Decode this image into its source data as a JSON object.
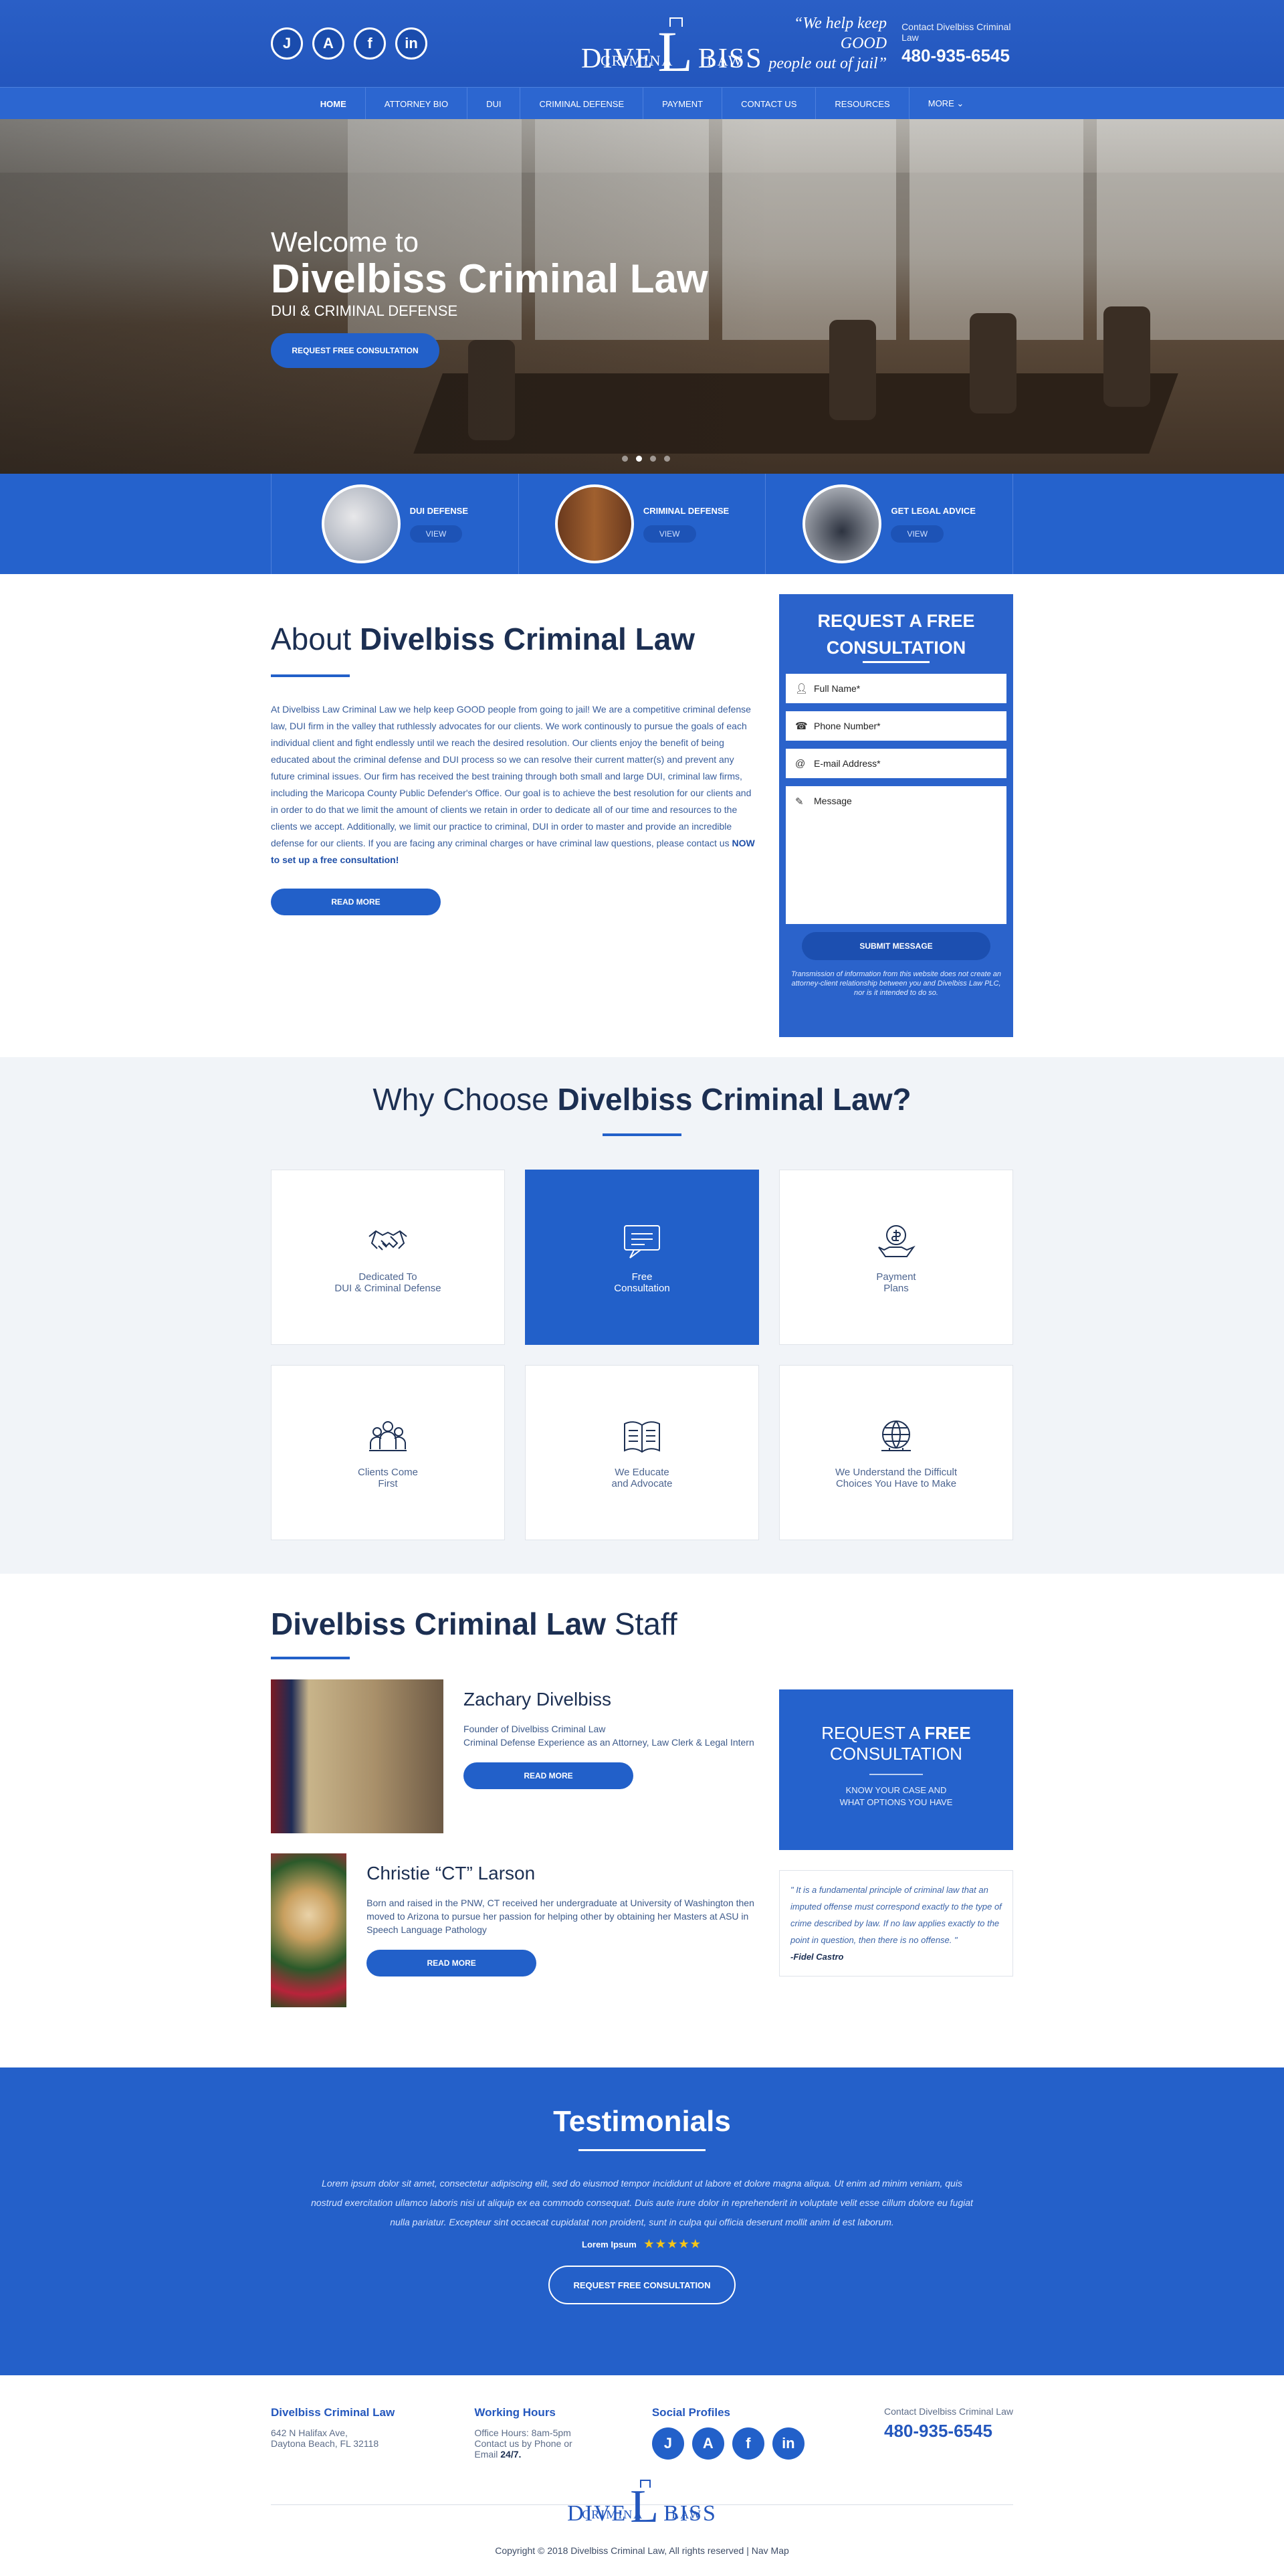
{
  "header": {
    "socials": [
      "J",
      "A",
      "f",
      "in"
    ],
    "logo": {
      "left": "DIVE",
      "L": "L",
      "right": "BISS",
      "sub_left": "CRIMINA",
      "sub_right": "LAW"
    },
    "slogan_line1": "“We help keep GOOD",
    "slogan_line2": "people out of jail”",
    "contact_label": "Contact Divelbiss Criminal Law",
    "phone": "480-935-6545"
  },
  "nav": [
    "HOME",
    "ATTORNEY BIO",
    "DUI",
    "CRIMINAL DEFENSE",
    "PAYMENT",
    "CONTACT US",
    "RESOURCES",
    "MORE ⌄"
  ],
  "hero": {
    "welcome": "Welcome to",
    "name": "Divelbiss Criminal Law",
    "sub": "DUI & CRIMINAL DEFENSE",
    "button": "REQUEST FREE CONSULTATION"
  },
  "services": [
    {
      "title": "DUI DEFENSE",
      "view": "VIEW"
    },
    {
      "title": "CRIMINAL DEFENSE",
      "view": "VIEW"
    },
    {
      "title": "GET LEGAL ADVICE",
      "view": "VIEW"
    }
  ],
  "about": {
    "title_light": "About ",
    "title_bold": "Divelbiss Criminal Law",
    "body": "At Divelbiss Law Criminal Law we help keep GOOD people from going to jail! We are a competitive criminal defense law, DUI firm in the valley that ruthlessly advocates for our clients. We work continously to pursue the goals of each individual client and fight endlessly until we reach the desired resolution. Our clients enjoy the benefit of being educated about the criminal defense and DUI process so we can resolve their current matter(s) and prevent any future criminal issues. Our firm has received the best training through both small and large DUI, criminal law firms, including the Maricopa County Public Defender's Office. Our goal is to achieve the best resolution for our clients and in order to do that we limit the amount of clients we retain in order to dedicate all of our time and resources to the clients we accept. Additionally, we limit our practice to criminal, DUI in order to master and provide an incredible defense for our clients. If you are facing any criminal charges or have criminal law questions, please contact us ",
    "body_bold": "NOW to set up a free consultation!",
    "button": "READ MORE"
  },
  "form": {
    "title": "REQUEST A FREE CONSULTATION",
    "fields": [
      "Full Name*",
      "Phone Number*",
      "E-mail Address*",
      "Message"
    ],
    "button": "SUBMIT MESSAGE",
    "note": "Transmission of information from this website does not create an attorney-client relationship between you and Divelbiss Law PLC, nor is it intended to do so."
  },
  "why": {
    "title_light": "Why Choose ",
    "title_bold": "Divelbiss Criminal Law?",
    "cards": [
      {
        "line1": "Dedicated To",
        "line2": "DUI & Criminal Defense",
        "icon": "handshake-icon"
      },
      {
        "line1": "Free",
        "line2": "Consultation",
        "icon": "chat-icon"
      },
      {
        "line1": "Payment",
        "line2": "Plans",
        "icon": "money-hand-icon"
      },
      {
        "line1": "Clients Come",
        "line2": "First",
        "icon": "people-icon"
      },
      {
        "line1": "We Educate",
        "line2": "and Advocate",
        "icon": "book-icon"
      },
      {
        "line1": "We Understand the Difficult",
        "line2": "Choices You Have to Make",
        "icon": "globe-icon"
      }
    ]
  },
  "staff": {
    "title_bold": "Divelbiss Criminal Law",
    "title_light": " Staff",
    "members": [
      {
        "name": "Zachary Divelbiss",
        "bio_line1": "Founder of Divelbiss Criminal Law",
        "bio_line2": "Criminal Defense Experience as an Attorney, Law Clerk & Legal Intern",
        "button": "READ MORE"
      },
      {
        "name": "Christie “CT” Larson",
        "bio_line1": "Born and raised in the PNW, CT received her undergraduate at University of Washington then moved to Arizona to pursue her passion for helping other by obtaining her Masters at ASU in Speech Language Pathology",
        "bio_line2": "",
        "button": "READ MORE"
      }
    ],
    "cta_title_light": "REQUEST A ",
    "cta_title_bold": "FREE",
    "cta_title2": "CONSULTATION",
    "cta_sub1": "KNOW YOUR CASE AND",
    "cta_sub2": "WHAT OPTIONS YOU HAVE",
    "quote": "\" It is a fundamental principle of criminal law that an imputed offense must correspond exactly to the type of crime described by law. If no law applies exactly to the point in question, then there is no offense. \"",
    "quote_author": "-Fidel Castro"
  },
  "testimonials": {
    "title": "Testimonials",
    "text": "Lorem ipsum dolor sit amet, consectetur adipiscing elit, sed do eiusmod tempor incididunt ut labore et dolore magna aliqua. Ut enim ad minim veniam, quis nostrud exercitation ullamco laboris nisi ut aliquip ex ea commodo consequat. Duis aute irure dolor in reprehenderit in voluptate velit esse cillum dolore eu fugiat nulla pariatur. Excepteur sint occaecat cupidatat non proident, sunt in culpa qui officia deserunt mollit anim id est laborum.",
    "author": "Lorem Ipsum",
    "stars": "★★★★★",
    "button": "REQUEST FREE CONSULTATION"
  },
  "footer": {
    "col1_title": "Divelbiss Criminal Law",
    "address1": "642 N Halifax Ave,",
    "address2": "Daytona Beach, FL 32118",
    "col2_title": "Working Hours",
    "hours1": "Office Hours: 8am-5pm",
    "hours2": "Contact us by Phone or",
    "hours3": "Email ",
    "hours_bold": "24/7.",
    "col3_title": "Social Profiles",
    "contact_label": "Contact Divelbiss Criminal Law",
    "phone": "480-935-6545",
    "copyright": "Copyright © 2018 Divelbiss Criminal Law, All rights reserved | Nav Map"
  },
  "colors": {
    "primary": "#2260c9",
    "dark_text": "#1c2f52"
  }
}
